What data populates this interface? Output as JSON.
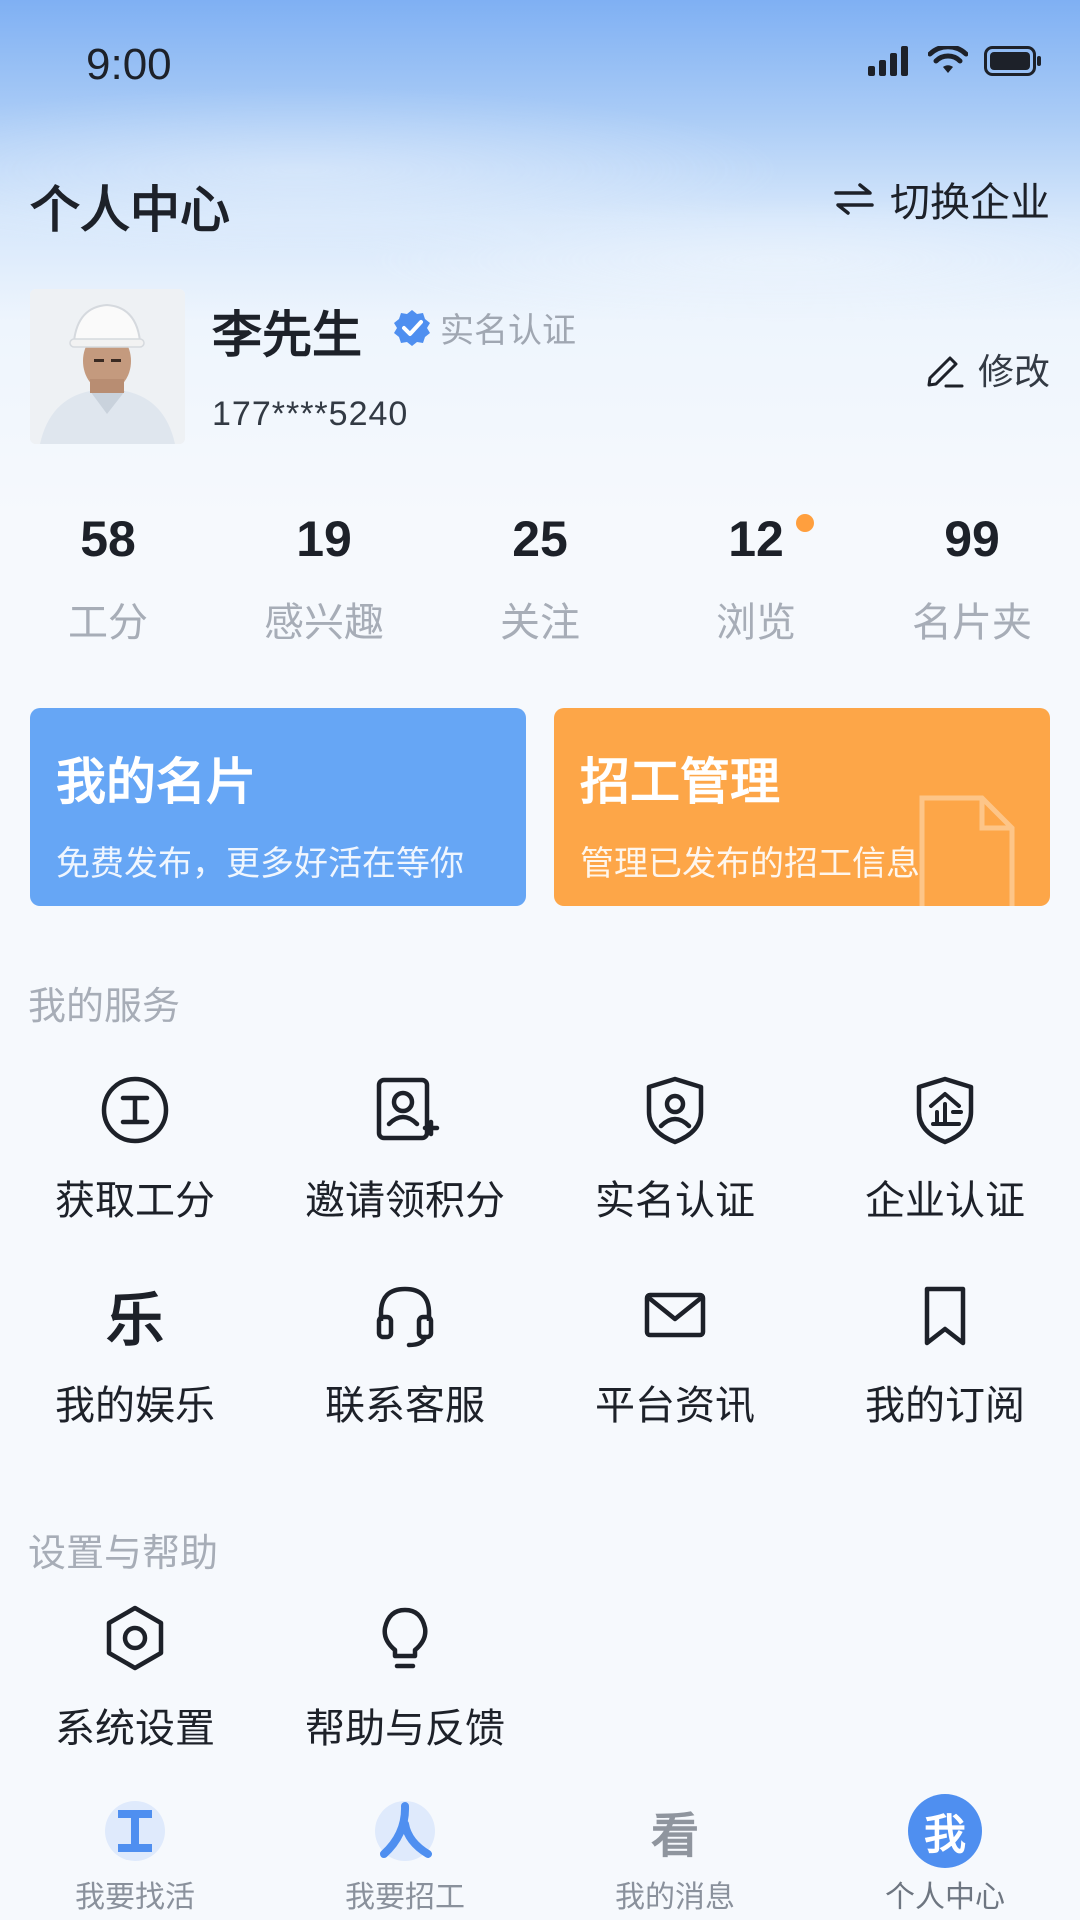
{
  "status_bar": {
    "time": "9:00"
  },
  "header": {
    "title": "个人中心",
    "switch_label": "切换企业"
  },
  "profile": {
    "name": "李先生",
    "verified_label": "实名认证",
    "phone": "177****5240",
    "edit_label": "修改"
  },
  "stats": [
    {
      "value": "58",
      "label": "工分"
    },
    {
      "value": "19",
      "label": "感兴趣"
    },
    {
      "value": "25",
      "label": "关注"
    },
    {
      "value": "12",
      "label": "浏览"
    },
    {
      "value": "99",
      "label": "名片夹"
    }
  ],
  "cards": [
    {
      "title": "我的名片",
      "subtitle": "免费发布，更多好活在等你",
      "color": "#66a6f5"
    },
    {
      "title": "招工管理",
      "subtitle": "管理已发布的招工信息",
      "color": "#fda648"
    }
  ],
  "services": {
    "section_title": "我的服务",
    "items": [
      {
        "label": "获取工分",
        "icon": "work-points-icon"
      },
      {
        "label": "邀请领积分",
        "icon": "invite-user-icon"
      },
      {
        "label": "实名认证",
        "icon": "id-shield-icon"
      },
      {
        "label": "企业认证",
        "icon": "enterprise-shield-icon"
      },
      {
        "label": "我的娱乐",
        "icon": "entertainment-icon",
        "glyph": "乐"
      },
      {
        "label": "联系客服",
        "icon": "headset-icon"
      },
      {
        "label": "平台资讯",
        "icon": "mail-icon"
      },
      {
        "label": "我的订阅",
        "icon": "bookmark-icon"
      }
    ]
  },
  "settings": {
    "section_title": "设置与帮助",
    "items": [
      {
        "label": "系统设置",
        "icon": "settings-hex-icon"
      },
      {
        "label": "帮助与反馈",
        "icon": "lightbulb-icon"
      }
    ]
  },
  "tabbar": [
    {
      "label": "我要找活",
      "glyph": "工"
    },
    {
      "label": "我要招工",
      "glyph": "人"
    },
    {
      "label": "我的消息",
      "glyph": "看"
    },
    {
      "label": "个人中心",
      "glyph": "我",
      "active": true
    }
  ],
  "colors": {
    "accent_blue": "#66a6f5",
    "accent_orange": "#fda648",
    "verify_blue": "#4f8ff0",
    "badge_dot": "#ff9f3e"
  }
}
